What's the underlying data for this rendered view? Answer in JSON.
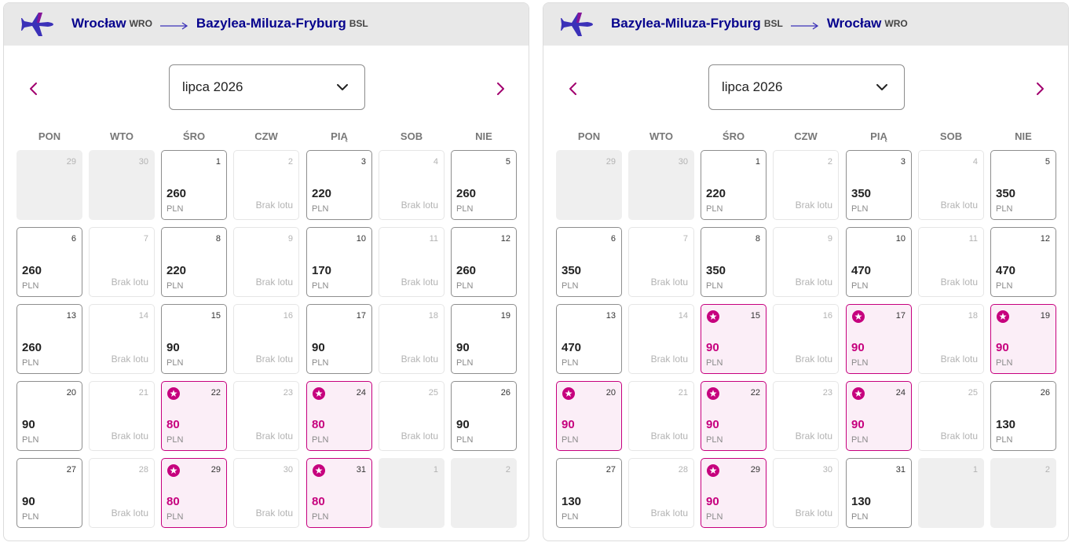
{
  "colors": {
    "brand_navy": "#06038d",
    "promo_magenta": "#c6007e",
    "header_bg": "#e8e8e8"
  },
  "icons": {
    "plane": "plane-icon",
    "arrow": "arrow-right-icon",
    "chevron_down": "chevron-down-icon",
    "prev": "chevron-left-icon",
    "next": "chevron-right-icon",
    "promo": "star-badge-icon"
  },
  "weekdays": [
    "PON",
    "WTO",
    "ŚRO",
    "CZW",
    "PIĄ",
    "SOB",
    "NIE"
  ],
  "panels": [
    {
      "from_city": "Wrocław",
      "from_code": "WRO",
      "to_city": "Bazylea-Miluza-Fryburg",
      "to_code": "BSL",
      "month_label": "lipca 2026",
      "cells": [
        {
          "day": "29",
          "state": "out"
        },
        {
          "day": "30",
          "state": "out"
        },
        {
          "day": "1",
          "state": "in",
          "price": "260",
          "currency": "PLN"
        },
        {
          "day": "2",
          "state": "none",
          "label": "Brak lotu"
        },
        {
          "day": "3",
          "state": "in",
          "price": "220",
          "currency": "PLN"
        },
        {
          "day": "4",
          "state": "none",
          "label": "Brak lotu"
        },
        {
          "day": "5",
          "state": "in",
          "price": "260",
          "currency": "PLN"
        },
        {
          "day": "6",
          "state": "in",
          "price": "260",
          "currency": "PLN"
        },
        {
          "day": "7",
          "state": "none",
          "label": "Brak lotu"
        },
        {
          "day": "8",
          "state": "in",
          "price": "220",
          "currency": "PLN"
        },
        {
          "day": "9",
          "state": "none",
          "label": "Brak lotu"
        },
        {
          "day": "10",
          "state": "in",
          "price": "170",
          "currency": "PLN"
        },
        {
          "day": "11",
          "state": "none",
          "label": "Brak lotu"
        },
        {
          "day": "12",
          "state": "in",
          "price": "260",
          "currency": "PLN"
        },
        {
          "day": "13",
          "state": "in",
          "price": "260",
          "currency": "PLN"
        },
        {
          "day": "14",
          "state": "none",
          "label": "Brak lotu"
        },
        {
          "day": "15",
          "state": "in",
          "price": "90",
          "currency": "PLN"
        },
        {
          "day": "16",
          "state": "none",
          "label": "Brak lotu"
        },
        {
          "day": "17",
          "state": "in",
          "price": "90",
          "currency": "PLN"
        },
        {
          "day": "18",
          "state": "none",
          "label": "Brak lotu"
        },
        {
          "day": "19",
          "state": "in",
          "price": "90",
          "currency": "PLN"
        },
        {
          "day": "20",
          "state": "in",
          "price": "90",
          "currency": "PLN"
        },
        {
          "day": "21",
          "state": "none",
          "label": "Brak lotu"
        },
        {
          "day": "22",
          "state": "promo",
          "price": "80",
          "currency": "PLN"
        },
        {
          "day": "23",
          "state": "none",
          "label": "Brak lotu"
        },
        {
          "day": "24",
          "state": "promo",
          "price": "80",
          "currency": "PLN"
        },
        {
          "day": "25",
          "state": "none",
          "label": "Brak lotu"
        },
        {
          "day": "26",
          "state": "in",
          "price": "90",
          "currency": "PLN"
        },
        {
          "day": "27",
          "state": "in",
          "price": "90",
          "currency": "PLN"
        },
        {
          "day": "28",
          "state": "none",
          "label": "Brak lotu"
        },
        {
          "day": "29",
          "state": "promo",
          "price": "80",
          "currency": "PLN"
        },
        {
          "day": "30",
          "state": "none",
          "label": "Brak lotu"
        },
        {
          "day": "31",
          "state": "promo",
          "price": "80",
          "currency": "PLN"
        },
        {
          "day": "1",
          "state": "out"
        },
        {
          "day": "2",
          "state": "out"
        }
      ]
    },
    {
      "from_city": "Bazylea-Miluza-Fryburg",
      "from_code": "BSL",
      "to_city": "Wrocław",
      "to_code": "WRO",
      "month_label": "lipca 2026",
      "cells": [
        {
          "day": "29",
          "state": "out"
        },
        {
          "day": "30",
          "state": "out"
        },
        {
          "day": "1",
          "state": "in",
          "price": "220",
          "currency": "PLN"
        },
        {
          "day": "2",
          "state": "none",
          "label": "Brak lotu"
        },
        {
          "day": "3",
          "state": "in",
          "price": "350",
          "currency": "PLN"
        },
        {
          "day": "4",
          "state": "none",
          "label": "Brak lotu"
        },
        {
          "day": "5",
          "state": "in",
          "price": "350",
          "currency": "PLN"
        },
        {
          "day": "6",
          "state": "in",
          "price": "350",
          "currency": "PLN"
        },
        {
          "day": "7",
          "state": "none",
          "label": "Brak lotu"
        },
        {
          "day": "8",
          "state": "in",
          "price": "350",
          "currency": "PLN"
        },
        {
          "day": "9",
          "state": "none",
          "label": "Brak lotu"
        },
        {
          "day": "10",
          "state": "in",
          "price": "470",
          "currency": "PLN"
        },
        {
          "day": "11",
          "state": "none",
          "label": "Brak lotu"
        },
        {
          "day": "12",
          "state": "in",
          "price": "470",
          "currency": "PLN"
        },
        {
          "day": "13",
          "state": "in",
          "price": "470",
          "currency": "PLN"
        },
        {
          "day": "14",
          "state": "none",
          "label": "Brak lotu"
        },
        {
          "day": "15",
          "state": "promo",
          "price": "90",
          "currency": "PLN"
        },
        {
          "day": "16",
          "state": "none",
          "label": "Brak lotu"
        },
        {
          "day": "17",
          "state": "promo",
          "price": "90",
          "currency": "PLN"
        },
        {
          "day": "18",
          "state": "none",
          "label": "Brak lotu"
        },
        {
          "day": "19",
          "state": "promo",
          "price": "90",
          "currency": "PLN"
        },
        {
          "day": "20",
          "state": "promo",
          "price": "90",
          "currency": "PLN"
        },
        {
          "day": "21",
          "state": "none",
          "label": "Brak lotu"
        },
        {
          "day": "22",
          "state": "promo",
          "price": "90",
          "currency": "PLN"
        },
        {
          "day": "23",
          "state": "none",
          "label": "Brak lotu"
        },
        {
          "day": "24",
          "state": "promo",
          "price": "90",
          "currency": "PLN"
        },
        {
          "day": "25",
          "state": "none",
          "label": "Brak lotu"
        },
        {
          "day": "26",
          "state": "in",
          "price": "130",
          "currency": "PLN"
        },
        {
          "day": "27",
          "state": "in",
          "price": "130",
          "currency": "PLN"
        },
        {
          "day": "28",
          "state": "none",
          "label": "Brak lotu"
        },
        {
          "day": "29",
          "state": "promo",
          "price": "90",
          "currency": "PLN"
        },
        {
          "day": "30",
          "state": "none",
          "label": "Brak lotu"
        },
        {
          "day": "31",
          "state": "in",
          "price": "130",
          "currency": "PLN"
        },
        {
          "day": "1",
          "state": "out"
        },
        {
          "day": "2",
          "state": "out"
        }
      ]
    }
  ]
}
